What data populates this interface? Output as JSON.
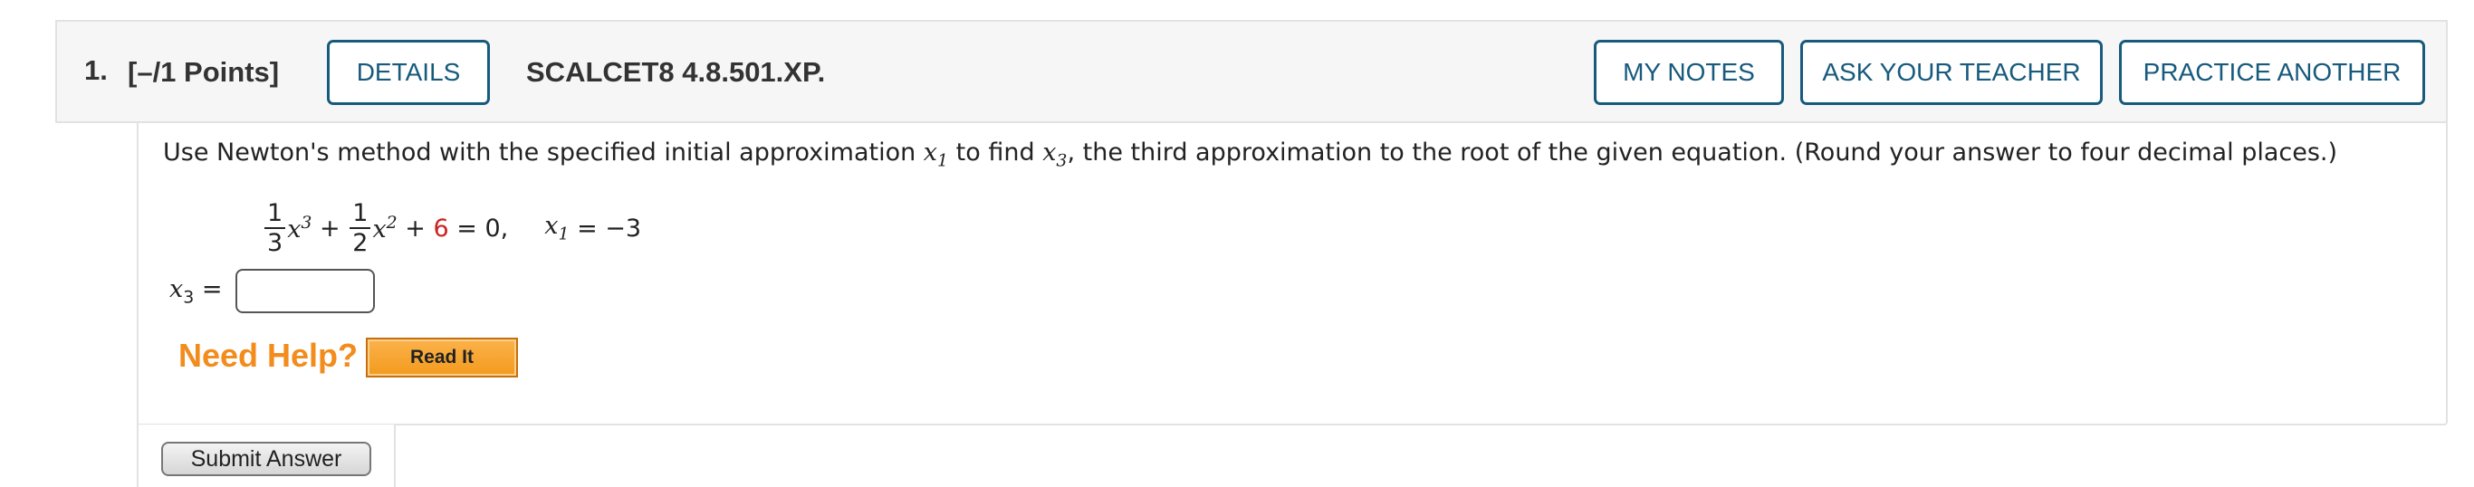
{
  "question": {
    "number": "1.",
    "points": "[–/1 Points]",
    "code": "SCALCET8 4.8.501.XP."
  },
  "header_buttons": {
    "details": "DETAILS",
    "my_notes": "MY NOTES",
    "ask_teacher": "ASK YOUR TEACHER",
    "practice_another": "PRACTICE ANOTHER"
  },
  "prompt": {
    "part1": "Use Newton's method with the specified initial approximation ",
    "var1": "x",
    "var1_sub": "1",
    "part2": " to find ",
    "var2": "x",
    "var2_sub": "3",
    "part3": ", the third approximation to the root of the given equation. (Round your answer to four decimal places.)"
  },
  "equation": {
    "frac1_num": "1",
    "frac1_den": "3",
    "term1_var": "x",
    "term1_exp": "3",
    "plus1": " + ",
    "frac2_num": "1",
    "frac2_den": "2",
    "term2_var": "x",
    "term2_exp": "2",
    "plus2": " + ",
    "constant": "6",
    "equals": " = 0,",
    "x1_var": "x",
    "x1_sub": "1",
    "x1_value": " = −3"
  },
  "answer": {
    "label_var": "x",
    "label_sub": "3",
    "label_eq": " =",
    "value": ""
  },
  "help": {
    "need_help": "Need Help?",
    "read_it": "Read It"
  },
  "submit": {
    "label": "Submit Answer"
  },
  "colors": {
    "accent": "#175a7c",
    "help_orange": "#f28c1c",
    "constant_red": "#cc2222"
  }
}
